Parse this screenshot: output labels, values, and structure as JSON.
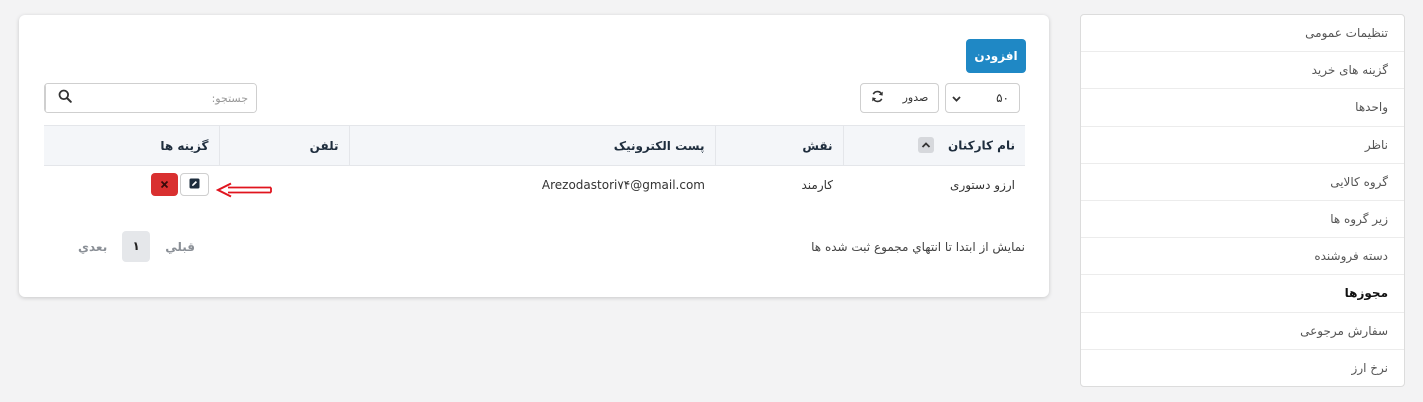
{
  "sidebar": {
    "items": [
      {
        "label": "تنظیمات عمومی"
      },
      {
        "label": "گزینه های خرید"
      },
      {
        "label": "واحدها"
      },
      {
        "label": "ناظر"
      },
      {
        "label": "گروه کالایی"
      },
      {
        "label": "زیر گروه ها"
      },
      {
        "label": "دسته فروشنده"
      },
      {
        "label": "مجوزها",
        "active": true
      },
      {
        "label": "سفارش مرجوعی"
      },
      {
        "label": "نرخ ارز"
      }
    ]
  },
  "toolbar": {
    "add_label": "افزودن",
    "search_placeholder": "جستجو:",
    "search_icon": "search-icon",
    "refresh_icon": "refresh-icon",
    "export_label": "صدور",
    "page_size": "۵۰"
  },
  "table": {
    "headers": {
      "name": "نام کارکنان",
      "role": "نقش",
      "email": "پست الکترونیک",
      "phone": "تلفن",
      "options": "گزینه ها"
    },
    "rows": [
      {
        "name": "ارزو دستوری",
        "role": "کارمند",
        "email": "Arezodastori۷۴@gmail.com",
        "phone": ""
      }
    ]
  },
  "footer": {
    "info": "نمایش از ابتدا تا انتهاي مجموع ثبت شده ها",
    "prev_label": "قبلي",
    "current_page": "۱",
    "next_label": "بعدي"
  },
  "colors": {
    "primary": "#1f88c5",
    "danger": "#d93030",
    "annotation": "#e0141e"
  }
}
